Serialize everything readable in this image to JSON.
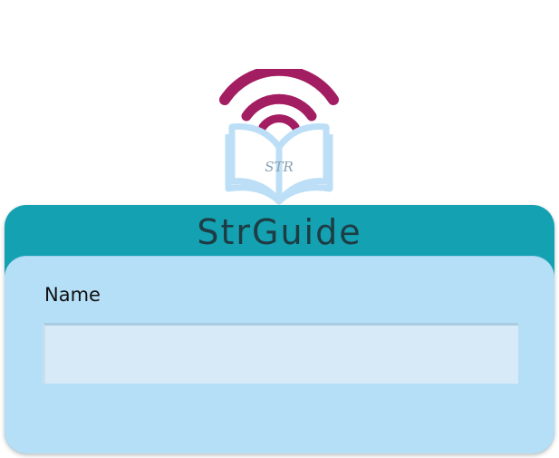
{
  "logo": {
    "monogram": "STR",
    "colors": {
      "signal": "#a31d62",
      "book": "#bcdff7",
      "monogram": "#8aa2b3"
    }
  },
  "app": {
    "title": "StrGuide"
  },
  "form": {
    "name_label": "Name",
    "name_value": "",
    "name_placeholder": ""
  },
  "colors": {
    "header": "#14a1b1",
    "panel": "#b5dff7",
    "input": "#d6eaf8",
    "title_text": "#1e3c44"
  }
}
